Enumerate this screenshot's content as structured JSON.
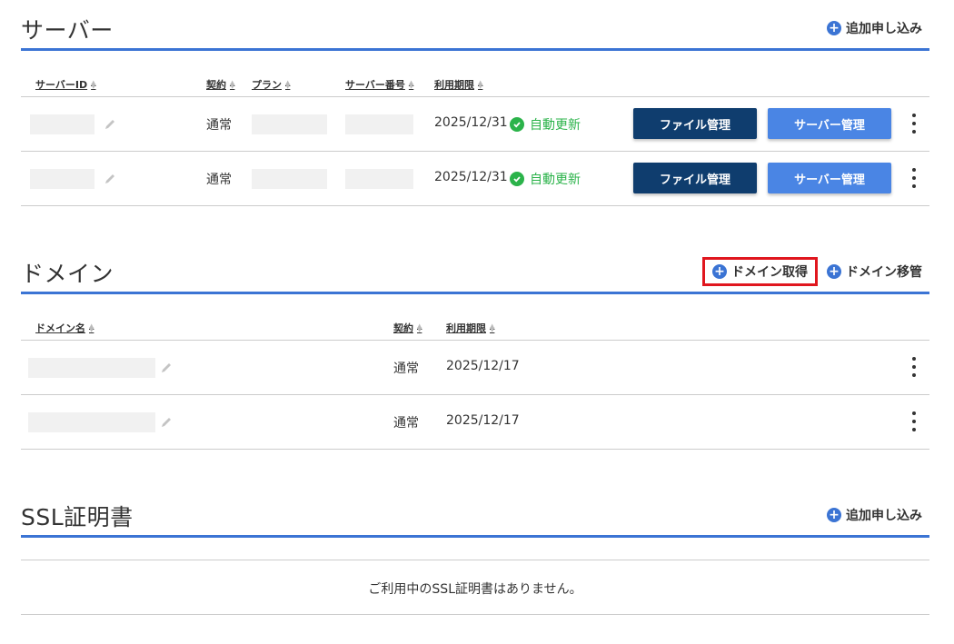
{
  "server": {
    "title": "サーバー",
    "add_label": "追加申し込み",
    "columns": {
      "server_id": "サーバーID",
      "contract": "契約",
      "plan": "プラン",
      "server_number": "サーバー番号",
      "expiry": "利用期限"
    },
    "rows": [
      {
        "contract": "通常",
        "expiry": "2025/12/31",
        "status": "自動更新",
        "file_btn": "ファイル管理",
        "server_btn": "サーバー管理"
      },
      {
        "contract": "通常",
        "expiry": "2025/12/31",
        "status": "自動更新",
        "file_btn": "ファイル管理",
        "server_btn": "サーバー管理"
      }
    ]
  },
  "domain": {
    "title": "ドメイン",
    "acquire_label": "ドメイン取得",
    "transfer_label": "ドメイン移管",
    "columns": {
      "domain_name": "ドメイン名",
      "contract": "契約",
      "expiry": "利用期限"
    },
    "rows": [
      {
        "contract": "通常",
        "expiry": "2025/12/17"
      },
      {
        "contract": "通常",
        "expiry": "2025/12/17"
      }
    ]
  },
  "ssl": {
    "title": "SSL証明書",
    "add_label": "追加申し込み",
    "empty_message": "ご利用中のSSL証明書はありません。"
  },
  "colors": {
    "accent": "#3b74d4",
    "dark_button": "#0f3d6e",
    "blue_button": "#4a85e4",
    "status_green": "#2bb34a",
    "highlight": "#e0161e"
  }
}
